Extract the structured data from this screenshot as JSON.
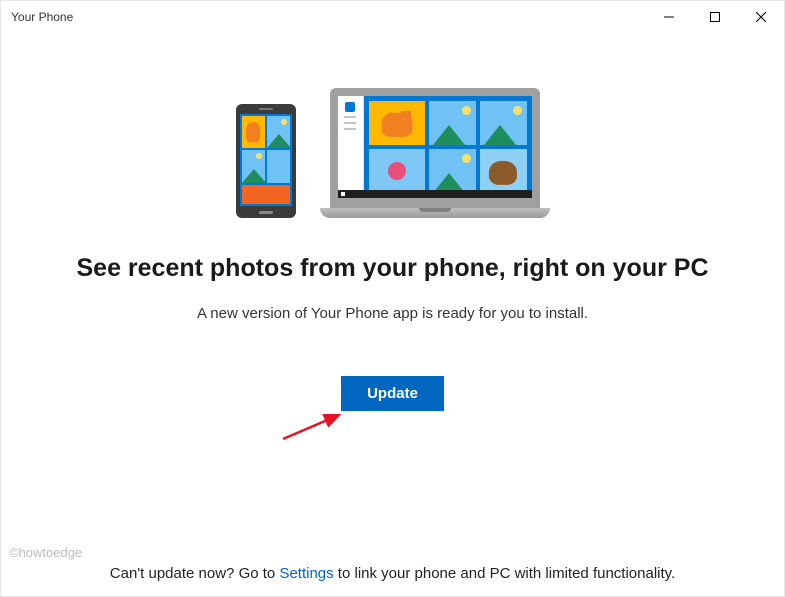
{
  "window": {
    "title": "Your Phone"
  },
  "main": {
    "headline": "See recent photos from your phone, right on your PC",
    "subtext": "A new version of Your Phone app is ready for you to install.",
    "update_button": "Update"
  },
  "footer": {
    "prefix": "Can't update now? Go to ",
    "link": "Settings",
    "suffix": " to link your phone and PC with limited functionality."
  },
  "watermark": "©howtoedge"
}
